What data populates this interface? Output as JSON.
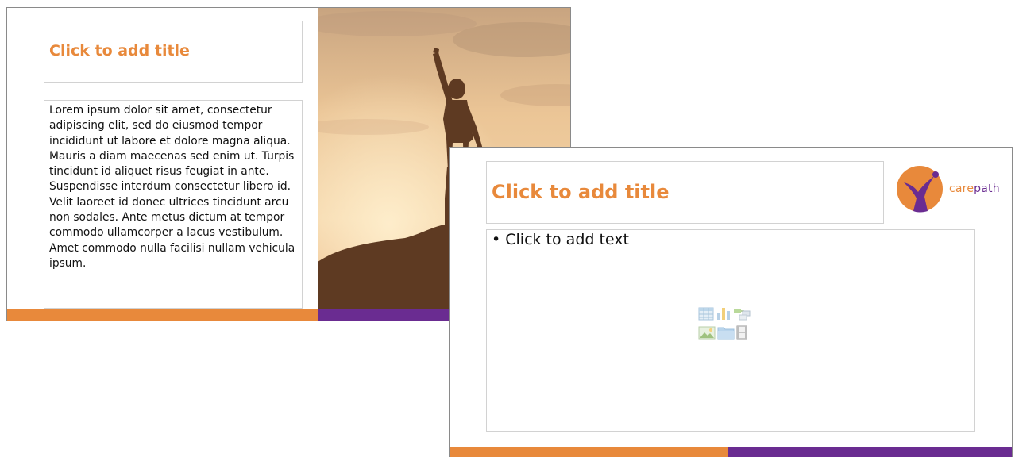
{
  "slide1": {
    "title_placeholder": "Click to add title",
    "body_text": "Lorem ipsum dolor sit amet, consectetur adipiscing elit, sed do eiusmod tempor incididunt ut labore et dolore magna aliqua. Mauris a diam maecenas sed enim ut. Turpis tincidunt id aliquet risus feugiat in ante. Suspendisse interdum consectetur libero id. Velit laoreet id donec ultrices tincidunt arcu non sodales. Ante metus dictum at tempor commodo ullamcorper a lacus vestibulum. Amet commodo nulla facilisi nullam vehicula ipsum.",
    "image": "silhouette-on-mountain-sunset"
  },
  "slide2": {
    "title_placeholder": "Click to add title",
    "content_placeholder": "• Click to add text",
    "logo": {
      "part1": "care",
      "part2": "path"
    },
    "content_icons": [
      "insert-table-icon",
      "insert-chart-icon",
      "insert-smartart-icon",
      "insert-picture-icon",
      "insert-folder-icon",
      "insert-video-icon"
    ]
  },
  "colors": {
    "brand_orange": "#e8893b",
    "brand_purple": "#6a2c91",
    "placeholder_border": "#d2d2d2"
  }
}
